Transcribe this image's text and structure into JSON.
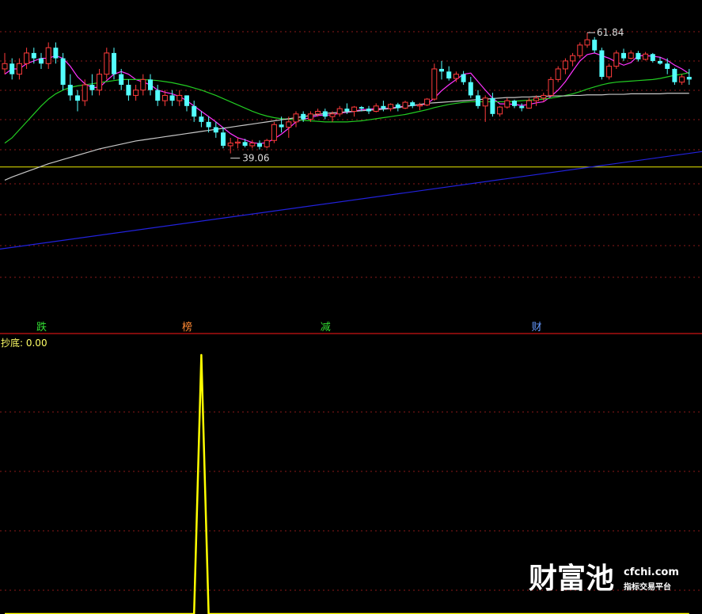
{
  "chart_data": [
    {
      "type": "candlestick",
      "title": "",
      "ylim": [
        10,
        68
      ],
      "max_label": "61.84",
      "min_label": "39.06",
      "horizontal_line": 36.5,
      "candles": [
        [
          55,
          58,
          54,
          56
        ],
        [
          56,
          57,
          53,
          54
        ],
        [
          54,
          57,
          53,
          56
        ],
        [
          56,
          59,
          55,
          58
        ],
        [
          58,
          59,
          56,
          57
        ],
        [
          57,
          58,
          55,
          56
        ],
        [
          56,
          60,
          55,
          59
        ],
        [
          59,
          60,
          56,
          57
        ],
        [
          57,
          58,
          51,
          52
        ],
        [
          52,
          54,
          49,
          50
        ],
        [
          50,
          51,
          47,
          49
        ],
        [
          49,
          53,
          48,
          52
        ],
        [
          52,
          54,
          50,
          51
        ],
        [
          51,
          55,
          50,
          54
        ],
        [
          54,
          59,
          53,
          58
        ],
        [
          58,
          59,
          53,
          54
        ],
        [
          54,
          55,
          51,
          52
        ],
        [
          52,
          53,
          49,
          50
        ],
        [
          50,
          52,
          49,
          51
        ],
        [
          51,
          54,
          50,
          53
        ],
        [
          53,
          54,
          50,
          51
        ],
        [
          51,
          52,
          48,
          49
        ],
        [
          49,
          51,
          48,
          50
        ],
        [
          50,
          51,
          48,
          49
        ],
        [
          49,
          51,
          48,
          50
        ],
        [
          50,
          50,
          47,
          48
        ],
        [
          48,
          49,
          45,
          46
        ],
        [
          46,
          47,
          44,
          45
        ],
        [
          45,
          46,
          43,
          44
        ],
        [
          44,
          45,
          42,
          43
        ],
        [
          43,
          44,
          40,
          40.5
        ],
        [
          40.5,
          42,
          39.06,
          41
        ],
        [
          41,
          42,
          40,
          41.2
        ],
        [
          41.2,
          41.8,
          40.2,
          40.5
        ],
        [
          40.5,
          41.6,
          40,
          41
        ],
        [
          41,
          41.5,
          39.8,
          40.3
        ],
        [
          40.3,
          41.8,
          40,
          41.5
        ],
        [
          41.5,
          45,
          41,
          44.5
        ],
        [
          44.5,
          46,
          43,
          44
        ],
        [
          44,
          46,
          42,
          45
        ],
        [
          45,
          47,
          44,
          46.5
        ],
        [
          46.5,
          47,
          45,
          45.5
        ],
        [
          45.5,
          47,
          45,
          46.5
        ],
        [
          46.5,
          47.5,
          46,
          47
        ],
        [
          47,
          47.5,
          45.5,
          46
        ],
        [
          46,
          47,
          45,
          46.5
        ],
        [
          46.5,
          48,
          46,
          47.5
        ],
        [
          47.5,
          48.5,
          46.5,
          47
        ],
        [
          47,
          48,
          46,
          47.8
        ],
        [
          47.8,
          48,
          47,
          47.5
        ],
        [
          47.5,
          48,
          46.5,
          47
        ],
        [
          47,
          48.5,
          46.8,
          48
        ],
        [
          48,
          49,
          47,
          47.5
        ],
        [
          47.5,
          48.5,
          47,
          48.3
        ],
        [
          48.3,
          48.6,
          47,
          47.6
        ],
        [
          47.6,
          49,
          47.4,
          48.7
        ],
        [
          48.7,
          49,
          47.6,
          48
        ],
        [
          48,
          48.6,
          47.2,
          48.2
        ],
        [
          48.2,
          49.5,
          48,
          49.3
        ],
        [
          49.3,
          56,
          49,
          55
        ],
        [
          55,
          56.5,
          53,
          54.5
        ],
        [
          54.5,
          55.5,
          52.8,
          53.2
        ],
        [
          53.2,
          54.5,
          52.5,
          54
        ],
        [
          54,
          54.6,
          52,
          52.5
        ],
        [
          52.5,
          53.5,
          49.5,
          50
        ],
        [
          50,
          51,
          47.5,
          48
        ],
        [
          48,
          50,
          45,
          49.5
        ],
        [
          49.5,
          50.5,
          46,
          46.5
        ],
        [
          46.5,
          48,
          46,
          47.8
        ],
        [
          47.8,
          49.5,
          47.5,
          49
        ],
        [
          49,
          49.2,
          47.6,
          48
        ],
        [
          48,
          48.5,
          47,
          47.6
        ],
        [
          47.6,
          49.5,
          47.5,
          49
        ],
        [
          49,
          50,
          48,
          49.5
        ],
        [
          49.5,
          50.5,
          48.8,
          50
        ],
        [
          50,
          53.5,
          49.8,
          53
        ],
        [
          53,
          55.5,
          52.5,
          55
        ],
        [
          55,
          57,
          54,
          56.5
        ],
        [
          56.5,
          58,
          55.5,
          57.5
        ],
        [
          57.5,
          60,
          57,
          59.5
        ],
        [
          59.5,
          61.84,
          59,
          60.5
        ],
        [
          60.5,
          61,
          58,
          58.5
        ],
        [
          58.5,
          59,
          53,
          53.5
        ],
        [
          53.5,
          56,
          53,
          55.5
        ],
        [
          55.5,
          58.5,
          55,
          58
        ],
        [
          58,
          58.8,
          56.5,
          57
        ],
        [
          57,
          58.5,
          56.8,
          58
        ],
        [
          58,
          58.4,
          56.4,
          56.8
        ],
        [
          56.8,
          58.2,
          56.6,
          57.8
        ],
        [
          57.8,
          58,
          56.2,
          56.5
        ],
        [
          56.5,
          57.2,
          55.8,
          56
        ],
        [
          56,
          57,
          54,
          55
        ],
        [
          55,
          55.2,
          52,
          52.5
        ],
        [
          52.5,
          54,
          52,
          53.5
        ],
        [
          53.5,
          55,
          52,
          53
        ]
      ],
      "series": [
        {
          "name": "MA5",
          "color": "#ff33ff",
          "values": [
            54,
            55,
            55,
            56,
            56.5,
            57,
            57,
            57.5,
            57,
            55.5,
            53.5,
            52.2,
            51.5,
            51.5,
            52.8,
            54,
            54.5,
            54,
            53,
            52.5,
            52,
            51,
            50.6,
            50.3,
            49.8,
            49,
            48,
            47,
            46,
            45,
            43.9,
            42.8,
            42,
            41.6,
            41.1,
            40.9,
            41.1,
            41.8,
            42.7,
            43.8,
            45,
            45.5,
            45.8,
            46.2,
            46.3,
            46.3,
            46.7,
            46.8,
            47,
            47.3,
            47.4,
            47.5,
            47.5,
            47.6,
            47.8,
            48,
            48.1,
            48.2,
            48.4,
            49.5,
            50.9,
            52,
            53,
            54,
            54.2,
            52.6,
            51,
            49.5,
            48.4,
            48.4,
            48.3,
            48.1,
            48.3,
            48.6,
            48.8,
            49.8,
            51,
            52.6,
            54.6,
            56.5,
            57.7,
            58,
            57.5,
            57,
            56.3,
            55.7,
            56.2,
            57.5,
            57.5,
            57.4,
            57.2,
            56.6,
            55.7,
            55,
            54.1
          ]
        },
        {
          "name": "MA20",
          "color": "#22cc22",
          "values": [
            41,
            42,
            43.5,
            45,
            46.5,
            48,
            49.3,
            50.3,
            51,
            51.5,
            51.8,
            52,
            52.2,
            52.4,
            52.6,
            52.8,
            53,
            53,
            53,
            53,
            52.9,
            52.8,
            52.6,
            52.4,
            52.1,
            51.8,
            51.4,
            51,
            50.5,
            50,
            49.4,
            48.8,
            48.2,
            47.6,
            47,
            46.5,
            46.1,
            45.8,
            45.6,
            45.5,
            45.4,
            45.3,
            45.2,
            45.1,
            45,
            45,
            45,
            45,
            45.1,
            45.2,
            45.4,
            45.6,
            45.8,
            46,
            46.2,
            46.4,
            46.7,
            47,
            47.3,
            47.7,
            48,
            48.3,
            48.5,
            48.7,
            48.8,
            48.8,
            48.8,
            48.8,
            48.8,
            48.8,
            48.9,
            49,
            49.1,
            49.2,
            49.3,
            49.5,
            49.7,
            50,
            50.3,
            50.7,
            51.2,
            51.6,
            52,
            52.3,
            52.5,
            52.6,
            52.7,
            52.8,
            52.9,
            53,
            53.2,
            53.5,
            53.8,
            54,
            54.3
          ]
        },
        {
          "name": "MA60",
          "color": "#c8c8c8",
          "values": [
            34,
            34.6,
            35.1,
            35.6,
            36.1,
            36.6,
            37.1,
            37.5,
            37.9,
            38.3,
            38.7,
            39.1,
            39.5,
            39.9,
            40.2,
            40.5,
            40.8,
            41.1,
            41.4,
            41.6,
            41.8,
            42,
            42.2,
            42.4,
            42.6,
            42.8,
            43,
            43.2,
            43.4,
            43.6,
            43.8,
            44,
            44.2,
            44.4,
            44.6,
            44.8,
            45,
            45.2,
            45.4,
            45.6,
            45.8,
            46,
            46.2,
            46.4,
            46.6,
            46.7,
            46.8,
            46.9,
            47,
            47.1,
            47.2,
            47.3,
            47.4,
            47.5,
            47.7,
            47.9,
            48.1,
            48.3,
            48.5,
            48.6,
            48.7,
            48.8,
            48.9,
            49,
            49.1,
            49.2,
            49.3,
            49.4,
            49.5,
            49.6,
            49.6,
            49.7,
            49.7,
            49.8,
            49.8,
            49.9,
            49.9,
            49.9,
            50,
            50,
            50.1,
            50.1,
            50.1,
            50.2,
            50.2,
            50.2,
            50.3,
            50.3,
            50.3,
            50.3,
            50.3,
            50.4,
            50.4,
            50.4,
            50.4
          ]
        },
        {
          "name": "MA250",
          "color": "#2222dd",
          "values": [
            21,
            39.4
          ]
        }
      ],
      "event_marks": [
        {
          "text": "跌",
          "candle": 5,
          "color": "#33dd33"
        },
        {
          "text": "榜",
          "candle": 25,
          "color": "#ff8833"
        },
        {
          "text": "减",
          "candle": 44,
          "color": "#33dd33"
        },
        {
          "text": "财",
          "candle": 73,
          "color": "#6699ff"
        }
      ]
    },
    {
      "type": "line",
      "title": "抄底: 0.00",
      "ylim": [
        0,
        1
      ],
      "series": [
        {
          "name": "抄底",
          "color": "#ffff00",
          "values": [
            0,
            0,
            0,
            0,
            0,
            0,
            0,
            0,
            0,
            0,
            0,
            0,
            0,
            0,
            0,
            0,
            0,
            0,
            0,
            0,
            0,
            0,
            0,
            0,
            0,
            0,
            0,
            1,
            0,
            0,
            0,
            0,
            0,
            0,
            0,
            0,
            0,
            0,
            0,
            0,
            0,
            0,
            0,
            0,
            0,
            0,
            0,
            0,
            0,
            0,
            0,
            0,
            0,
            0,
            0,
            0,
            0,
            0,
            0,
            0,
            0,
            0,
            0,
            0,
            0,
            0,
            0,
            0,
            0,
            0,
            0,
            0,
            0,
            0,
            0,
            0,
            0,
            0,
            0,
            0,
            0,
            0,
            0,
            0,
            0,
            0,
            0,
            0,
            0,
            0,
            0,
            0,
            0,
            0,
            0
          ]
        }
      ]
    }
  ],
  "watermark": {
    "brand": "财富池",
    "site": "cfchi.com",
    "slogan": "指标交易平台"
  }
}
